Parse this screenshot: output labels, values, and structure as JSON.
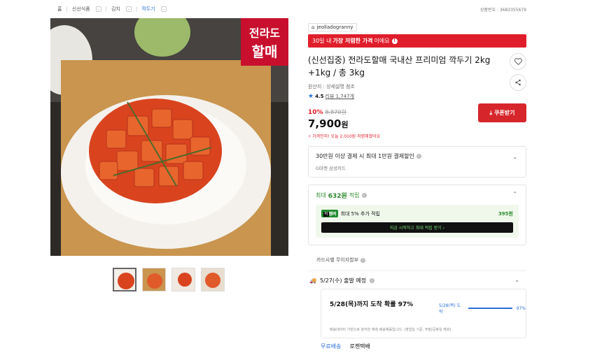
{
  "breadcrumb": {
    "home": "홈",
    "items": [
      "신선식품",
      "김치",
      "깍두기"
    ]
  },
  "product_no": "상품번호 : 3683355679",
  "seller": "jeolladogranny",
  "promo": {
    "pre": "30일 내",
    "bold": "가장 저렴한 가격",
    "post": "이에요"
  },
  "title": "(신선집중) 전라도할매 국내산 프리미엄 깍두기 2kg +1kg / 총 3kg",
  "origin": "원산지 : 상세설명 참조",
  "rating": {
    "score": "4.5",
    "reviews": "리뷰 1,747개"
  },
  "price": {
    "discount": "10%",
    "original": "8,870원",
    "current": "7,900",
    "unit": "원"
  },
  "coupon_label": "쿠폰받기",
  "lowest_note": "가격인하! 오늘 2,010원 저렴해졌어요",
  "card_discount": {
    "title": "30만원 이상 결제 시 최대 1만원 결제할인",
    "sub": "G마켓 삼성카드"
  },
  "points": {
    "pre": "최대",
    "amount": "632원",
    "post": "적립",
    "club": "최대 5% 추가 적립",
    "club_amount": "395원",
    "button": "지금 시작하고 최대 적립 받기 ›"
  },
  "badge": {
    "a": "적",
    "b": "멤버"
  },
  "card_installment": "카드사별 무이자할부",
  "shipping": {
    "date": "5/27(수) 출발 예정",
    "arrival": "5/28(목)까지 도착 확률 97%",
    "prob_label": "5/28(목) 도착",
    "prob_value": "97%",
    "note": "배송데이터 기반으로 분석한 예측 배송확률입니다. (영업일 기준, 주말/공휴일 제외)"
  },
  "tabs": [
    "무료배송",
    "로젠택배"
  ],
  "image_logo": [
    "전라도",
    "할매"
  ]
}
